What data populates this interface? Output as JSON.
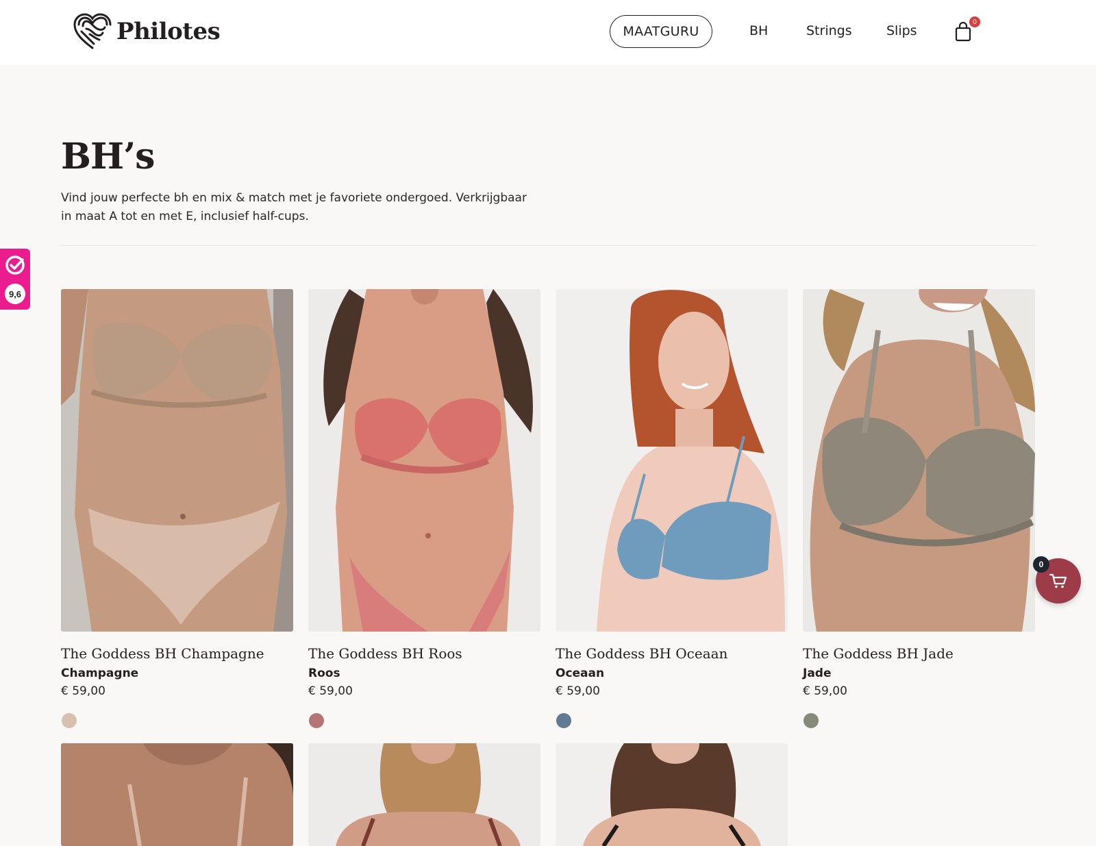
{
  "header": {
    "brand": "Philotes",
    "nav": {
      "size_guide": "MAATGURU",
      "bh": "BH",
      "strings": "Strings",
      "slips": "Slips"
    },
    "cart_count": "0"
  },
  "page": {
    "title": "BH’s",
    "intro": "Vind jouw perfecte bh en mix & match met je favoriete ondergoed. Verkrijgbaar in maat A tot en met E, inclusief half-cups."
  },
  "review_badge": {
    "score": "9,6",
    "accent": "#eb1c8d"
  },
  "products": [
    {
      "name": "The Goddess BH Champagne",
      "color": "Champagne",
      "price": "€ 59,00",
      "swatch": "#d9bfae"
    },
    {
      "name": "The Goddess BH Roos",
      "color": "Roos",
      "price": "€ 59,00",
      "swatch": "#b47575"
    },
    {
      "name": "The Goddess BH Oceaan",
      "color": "Oceaan",
      "price": "€ 59,00",
      "swatch": "#5f7a93"
    },
    {
      "name": "The Goddess BH Jade",
      "color": "Jade",
      "price": "€ 59,00",
      "swatch": "#858b78"
    }
  ],
  "floating_cart": {
    "count": "0",
    "color": "#9e3b48"
  },
  "colors": {
    "background": "#f9f8f6",
    "text": "#231f20",
    "cart_badge": "#d83f3c"
  }
}
